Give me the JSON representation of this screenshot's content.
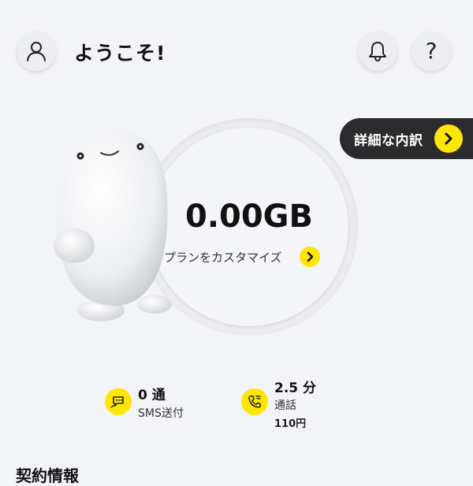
{
  "header": {
    "greeting": "ようこそ!",
    "icons": {
      "profile": "user-icon",
      "notifications": "bell-icon",
      "help": "help-icon"
    },
    "help_glyph": "?"
  },
  "detail": {
    "label": "詳細な内訳",
    "icon": "chevron-right-icon"
  },
  "usage": {
    "data_remaining": "0.00GB",
    "customize_label": "プランをカスタマイズ"
  },
  "stats": {
    "sms": {
      "value": "0 通",
      "label": "SMS送付",
      "icon": "sms-icon"
    },
    "call": {
      "value": "2.5 分",
      "label": "通話",
      "cost": "110円",
      "icon": "phone-icon"
    }
  },
  "section": {
    "heading": "契約情報"
  },
  "colors": {
    "accent": "#ffe600",
    "dark_pill": "#2b2b2e",
    "background": "#f3f4f8"
  }
}
